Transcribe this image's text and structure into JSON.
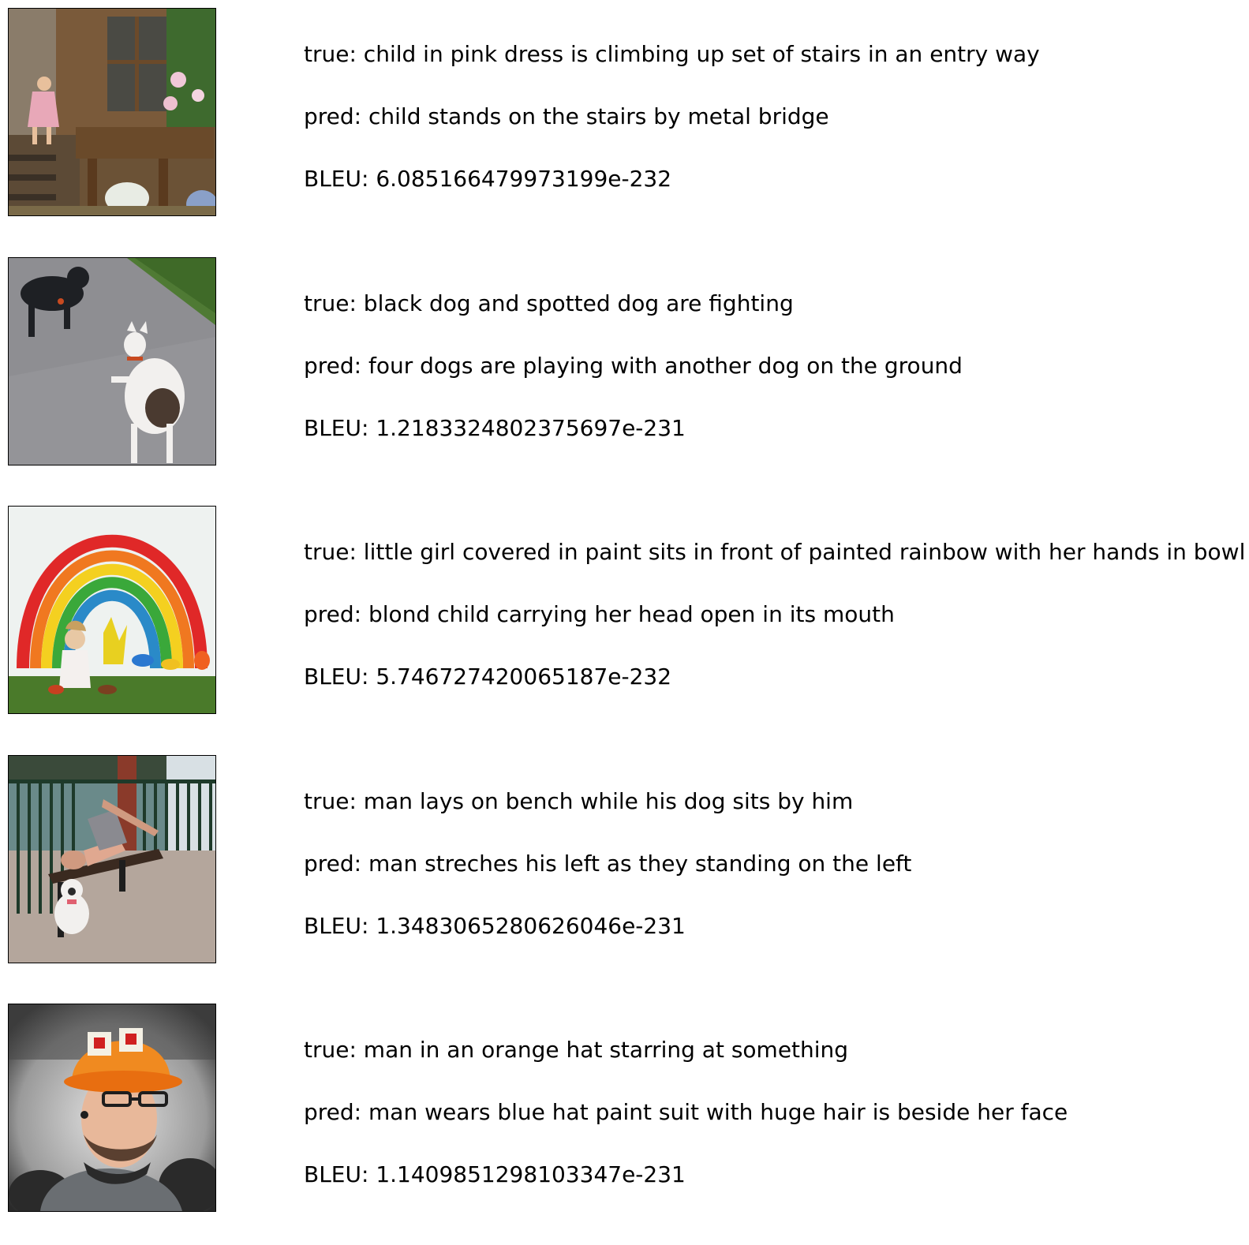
{
  "samples": [
    {
      "true_caption": "true: child in pink dress is climbing up set of stairs in an entry way",
      "pred_caption": "pred: child stands on the stairs by metal bridge",
      "bleu": "BLEU: 6.085166479973199e-232"
    },
    {
      "true_caption": "true: black dog and spotted dog are fighting",
      "pred_caption": "pred: four dogs are playing with another dog on the ground",
      "bleu": "BLEU: 1.2183324802375697e-231"
    },
    {
      "true_caption": "true: little girl covered in paint sits in front of painted rainbow with her hands in bowl",
      "pred_caption": "pred: blond child carrying her head open in its mouth",
      "bleu": "BLEU: 5.746727420065187e-232"
    },
    {
      "true_caption": "true: man lays on bench while his dog sits by him",
      "pred_caption": "pred: man streches his left as they standing on the left",
      "bleu": "BLEU: 1.3483065280626046e-231"
    },
    {
      "true_caption": "true: man in an orange hat starring at something",
      "pred_caption": "pred: man wears blue hat paint suit with huge hair is beside her face",
      "bleu": "BLEU: 1.1409851298103347e-231"
    }
  ]
}
